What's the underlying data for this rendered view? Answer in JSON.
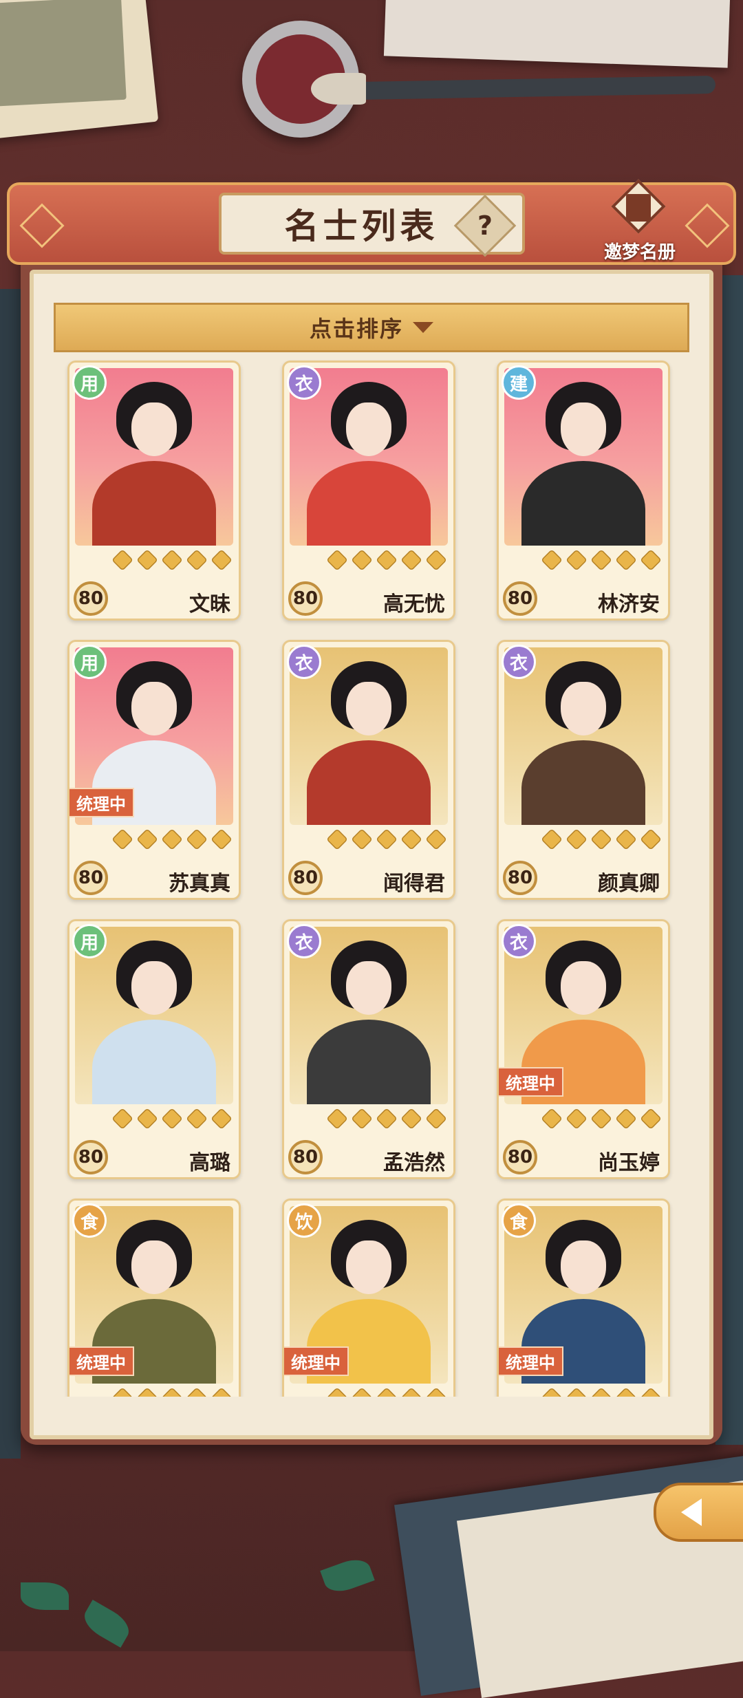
{
  "header": {
    "title": "名士列表",
    "help_label": "?",
    "register_label": "邀梦名册"
  },
  "sort": {
    "label": "点击排序"
  },
  "category_colors": {
    "用": "#6cc07a",
    "衣": "#9a7bd0",
    "建": "#5fb6dc",
    "食": "#e6a347",
    "饮": "#e6a347"
  },
  "cards": [
    {
      "name": "文昧",
      "category": "用",
      "level": "80",
      "status": "",
      "frame": "pink",
      "stars": 5,
      "outfit": "#b33a2a"
    },
    {
      "name": "高无忧",
      "category": "衣",
      "level": "80",
      "status": "",
      "frame": "pink",
      "stars": 5,
      "outfit": "#d8453a"
    },
    {
      "name": "林济安",
      "category": "建",
      "level": "80",
      "status": "",
      "frame": "pink",
      "stars": 5,
      "outfit": "#2a2a2a"
    },
    {
      "name": "苏真真",
      "category": "用",
      "level": "80",
      "status": "统理中",
      "frame": "pink",
      "stars": 5,
      "outfit": "#e9edf2"
    },
    {
      "name": "闻得君",
      "category": "衣",
      "level": "80",
      "status": "",
      "frame": "gold",
      "stars": 5,
      "outfit": "#b43a2c"
    },
    {
      "name": "颜真卿",
      "category": "衣",
      "level": "80",
      "status": "",
      "frame": "gold",
      "stars": 5,
      "outfit": "#5a3e2e"
    },
    {
      "name": "高璐",
      "category": "用",
      "level": "80",
      "status": "",
      "frame": "gold",
      "stars": 5,
      "outfit": "#cfe0ee"
    },
    {
      "name": "孟浩然",
      "category": "衣",
      "level": "80",
      "status": "",
      "frame": "gold",
      "stars": 5,
      "outfit": "#3b3b3b"
    },
    {
      "name": "尚玉婷",
      "category": "衣",
      "level": "80",
      "status": "统理中",
      "frame": "gold",
      "stars": 5,
      "outfit": "#f09a4a"
    },
    {
      "name": "",
      "category": "食",
      "level": "",
      "status": "统理中",
      "frame": "gold",
      "stars": 5,
      "outfit": "#6b6a3a"
    },
    {
      "name": "",
      "category": "饮",
      "level": "",
      "status": "统理中",
      "frame": "gold",
      "stars": 5,
      "outfit": "#f2c24a"
    },
    {
      "name": "",
      "category": "食",
      "level": "",
      "status": "统理中",
      "frame": "gold",
      "stars": 5,
      "outfit": "#2f4f78"
    }
  ]
}
